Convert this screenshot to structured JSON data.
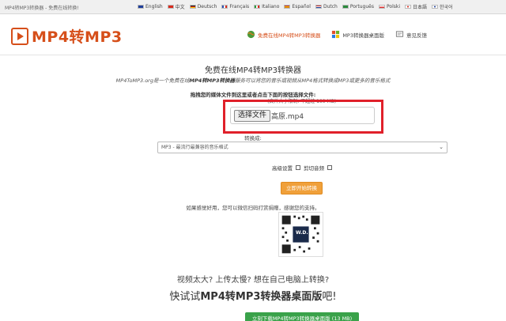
{
  "topbar": {
    "tagline": "MP4转MP3转换器 - 免费在线转换!",
    "languages": [
      {
        "label": "English",
        "color": "#1f3f9a"
      },
      {
        "label": "中文",
        "color": "#d92a1c"
      },
      {
        "label": "Deutsch",
        "color": "#222222"
      },
      {
        "label": "Français",
        "color": "#2b4fb0"
      },
      {
        "label": "Italiano",
        "color": "#2a9a3b"
      },
      {
        "label": "Español",
        "color": "#d9a01c"
      },
      {
        "label": "Dutch",
        "color": "#c02a2a"
      },
      {
        "label": "Português",
        "color": "#2a8a3b"
      },
      {
        "label": "Polski",
        "color": "#dd3333"
      },
      {
        "label": "日本語",
        "color": "#ffffff"
      },
      {
        "label": "한국어",
        "color": "#ffffff"
      }
    ]
  },
  "header": {
    "logo": "MP4转MP3",
    "nav": [
      {
        "label": "免费在线MP4转MP3转换器",
        "icon": "globe-icon"
      },
      {
        "label": "MP3转换器桌面版",
        "icon": "windows-icon"
      },
      {
        "label": "意见反馈",
        "icon": "feedback-icon"
      }
    ]
  },
  "main": {
    "heading": "免费在线MP4转MP3转换器",
    "intro_prefix": "MP4ToMP3.org是一个免费在线",
    "intro_bold": "MP4转MP3转换器",
    "intro_suffix": "服务可以将您的音乐或视频从MP4格式转换成MP3或更多的音乐格式",
    "drop_label": "拖拽您的媒体文件到这里或者点击下面的按钮选择文件:",
    "drop_hint": "(文件大小限制: 不超过 100 MB)",
    "file_button": "选择文件",
    "file_name": "高原.mp4",
    "format_label": "转换成:",
    "format_value": "MP3 - 最流行最兼容的音乐格式",
    "advanced_label": "高级设置",
    "cut_label": "剪切音频",
    "convert_button": "立即开始转换",
    "thanks_text": "如果感觉好用，您可以微信扫码打赏捐赠，感谢您的支持。",
    "qr_text": "W.D.",
    "promo_line1": "视频太大? 上传太慢? 想在自己电脑上转换?",
    "promo_line2_prefix": "快试试",
    "promo_line2_bold": "MP4转MP3转换器桌面版",
    "promo_line2_suffix": "吧!",
    "download_button": "立刻下载MP4转MP3转换器桌面版 (13 MB)"
  },
  "colors": {
    "brand": "#d64f1a",
    "highlight_box": "#e0202a",
    "convert_button": "#f0a03a",
    "download_button": "#3aa24a"
  }
}
